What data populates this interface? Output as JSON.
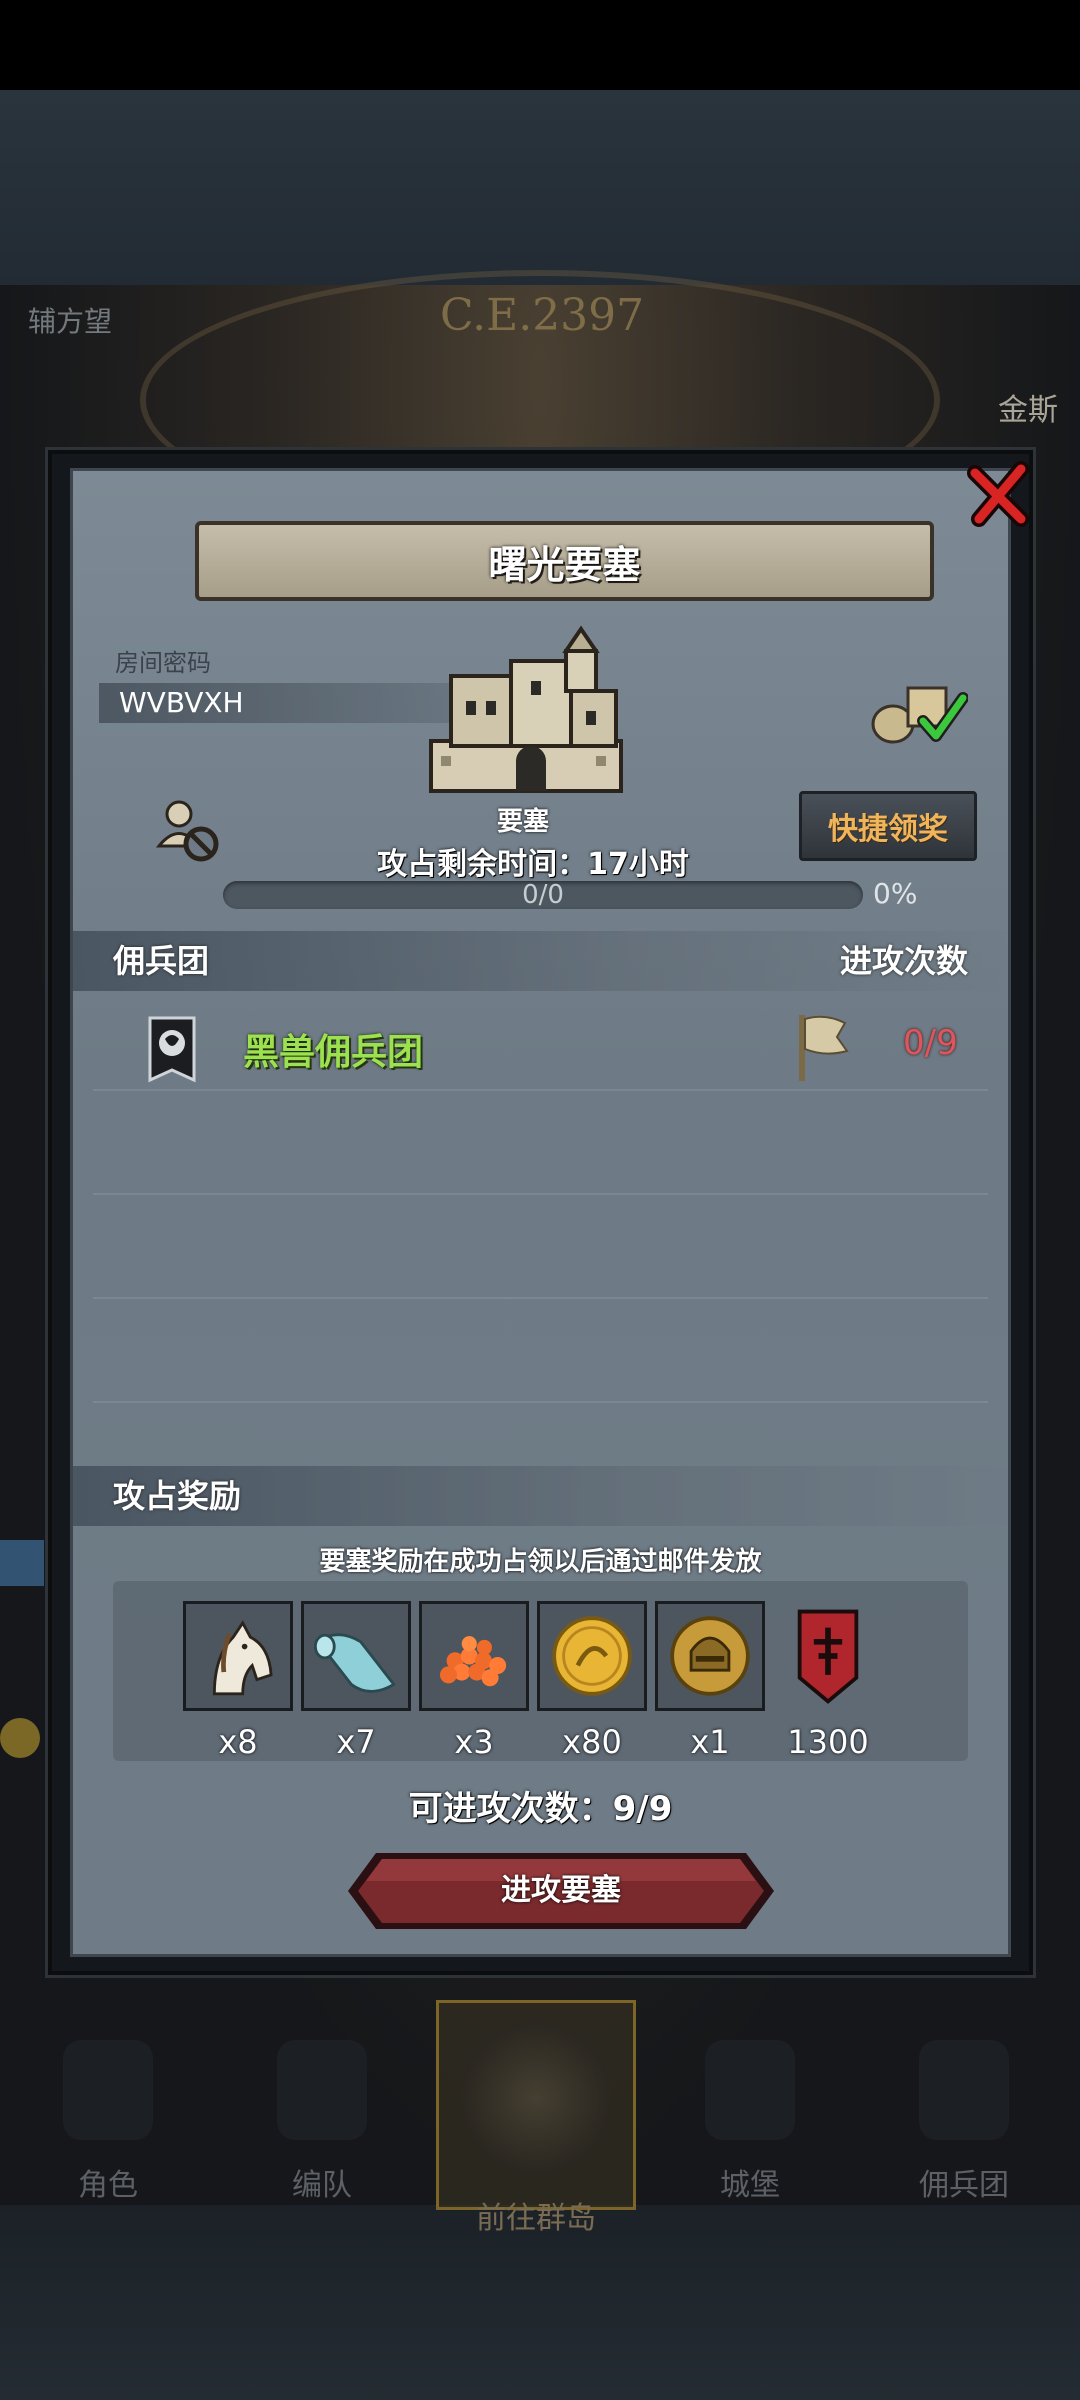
{
  "background": {
    "era": "C.E.2397",
    "top_left_fragment": "辅方望",
    "top_right_fragment": "金斯",
    "nav": [
      {
        "label": "角色"
      },
      {
        "label": "编队"
      },
      {
        "label": "前往群岛",
        "active": true
      },
      {
        "label": "城堡"
      },
      {
        "label": "佣兵团"
      }
    ]
  },
  "modal": {
    "title": "曙光要塞",
    "room_label": "房间密码",
    "room_code": "WVBVXH",
    "fortress_name": "要塞",
    "quick_claim_label": "快捷领奖",
    "time_left": "攻占剩余时间：17小时",
    "progress_text": "0/0",
    "progress_percent": "0%",
    "progress_value": 0,
    "mercenary_header": "佣兵团",
    "attacks_header": "进攻次数",
    "mercenaries": [
      {
        "name": "黑兽佣兵团",
        "attacks": "0/9"
      }
    ],
    "reward_header": "攻占奖励",
    "reward_note": "要塞奖励在成功占领以后通过邮件发放",
    "rewards": [
      {
        "icon": "horse-icon",
        "qty": "x8"
      },
      {
        "icon": "cloth-roll-icon",
        "qty": "x7"
      },
      {
        "icon": "berries-icon",
        "qty": "x3"
      },
      {
        "icon": "gold-coin-icon",
        "qty": "x80"
      },
      {
        "icon": "helmet-medal-icon",
        "qty": "x1"
      },
      {
        "icon": "red-banner-icon",
        "qty": "1300"
      }
    ],
    "attacks_remaining": "可进攻次数：9/9",
    "attack_button_label": "进攻要塞"
  },
  "colors": {
    "merc_name": "#9ce14f",
    "attack_count": "#e0555a",
    "quick_claim_text": "#f0b45a",
    "attack_button": "#7a2a2c"
  }
}
